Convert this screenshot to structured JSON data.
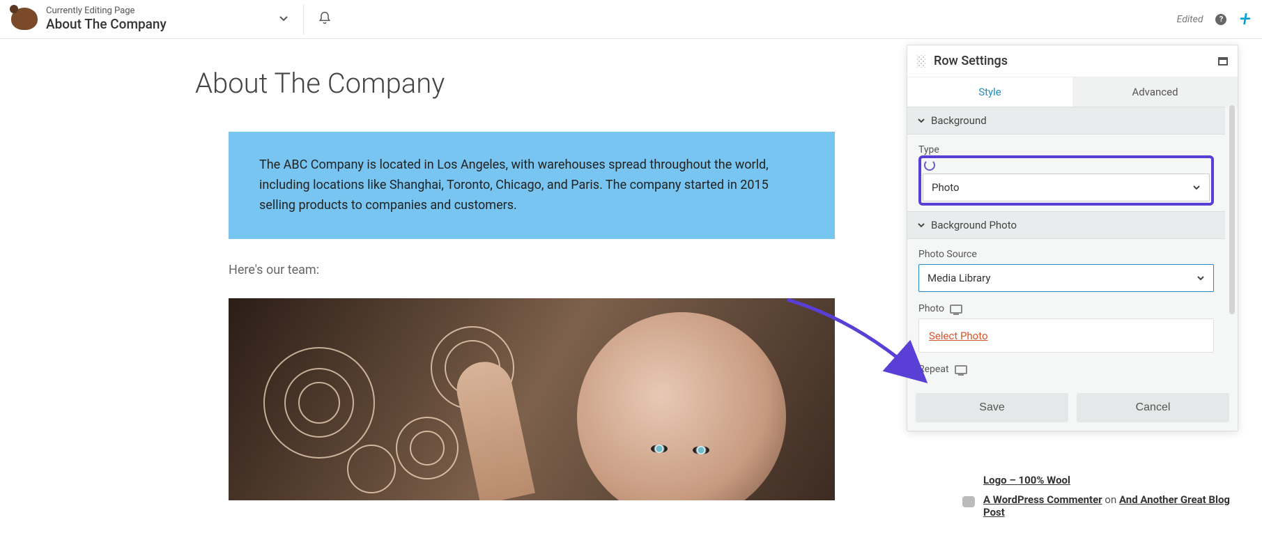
{
  "topbar": {
    "editing_label": "Currently Editing Page",
    "page_name": "About The Company",
    "edited_label": "Edited"
  },
  "page": {
    "title": "About The Company",
    "intro_paragraph": "The ABC Company is located in Los Angeles, with warehouses spread throughout the world, including locations like Shanghai, Toronto, Chicago, and Paris. The company started in 2015 selling products to companies and customers.",
    "team_caption": "Here's our team:"
  },
  "panel": {
    "title": "Row Settings",
    "tabs": {
      "style": "Style",
      "advanced": "Advanced"
    },
    "section_background": "Background",
    "field_type": "Type",
    "type_value": "Photo",
    "section_background_photo": "Background Photo",
    "field_photo_source": "Photo Source",
    "photo_source_value": "Media Library",
    "field_photo": "Photo",
    "select_photo": "Select Photo",
    "field_repeat": "Repeat",
    "save": "Save",
    "cancel": "Cancel"
  },
  "comments": {
    "c1_link": "Logo – 100% Wool",
    "c2_author": "A WordPress Commenter",
    "c2_on": " on ",
    "c2_post": "And Another Great Blog Post"
  }
}
